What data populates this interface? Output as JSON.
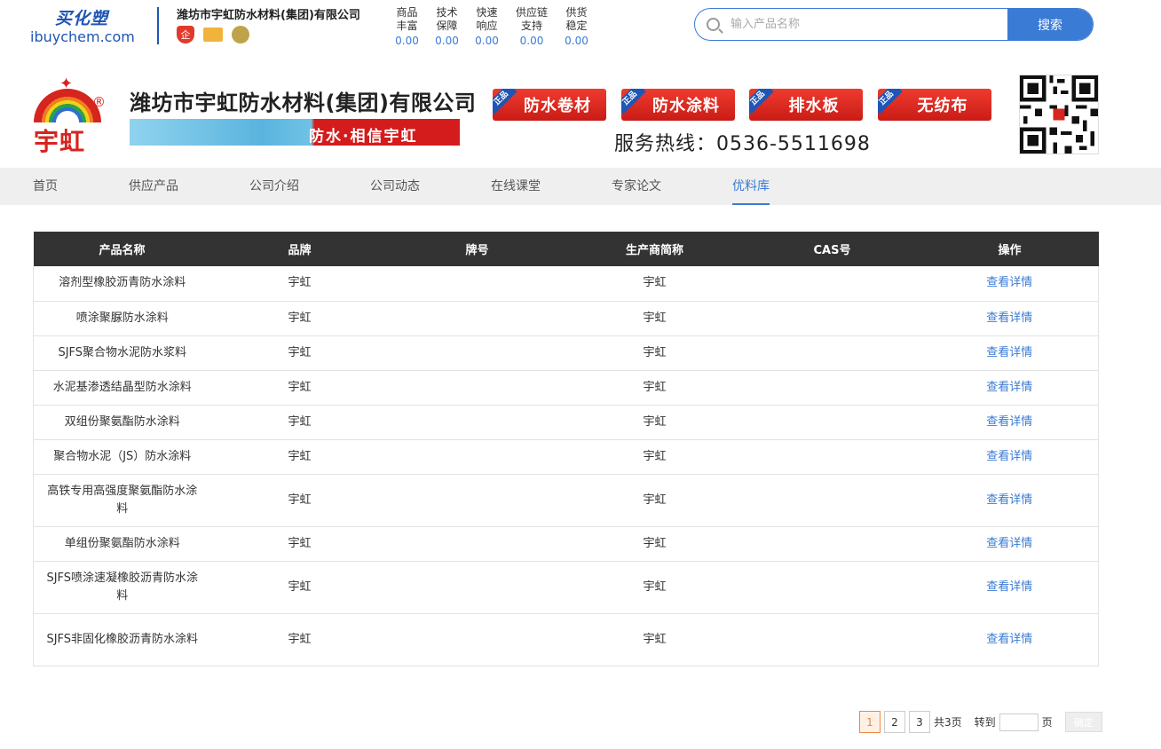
{
  "header": {
    "logo_cn": "买化塑",
    "logo_en_a": "ibuy",
    "logo_en_b": "chem",
    "logo_en_c": ".com",
    "company": "潍坊市宇虹防水材料(集团)有限公司",
    "badge_qi": "企",
    "metrics": [
      {
        "l1": "商品",
        "l2": "丰富",
        "v": "0.00"
      },
      {
        "l1": "技术",
        "l2": "保障",
        "v": "0.00"
      },
      {
        "l1": "快速",
        "l2": "响应",
        "v": "0.00"
      },
      {
        "l1": "供应链",
        "l2": "支持",
        "v": "0.00"
      },
      {
        "l1": "供货",
        "l2": "稳定",
        "v": "0.00"
      }
    ],
    "search": {
      "placeholder": "输入产品名称",
      "button": "搜索"
    }
  },
  "banner": {
    "brand": "宇虹",
    "title": "潍坊市宇虹防水材料(集团)有限公司",
    "slogan": "防水·相信宇虹",
    "tag": "正品",
    "products": [
      "防水卷材",
      "防水涂料",
      "排水板",
      "无纺布"
    ],
    "hotline": "服务热线：0536-5511698"
  },
  "nav": {
    "items": [
      "首页",
      "供应产品",
      "公司介绍",
      "公司动态",
      "在线课堂",
      "专家论文",
      "优料库"
    ],
    "active": "优料库"
  },
  "table": {
    "headers": [
      "产品名称",
      "品牌",
      "牌号",
      "生产商简称",
      "CAS号",
      "操作"
    ],
    "rows": [
      {
        "name": "溶剂型橡胶沥青防水涂料",
        "brand": "宇虹",
        "grade": "",
        "maker": "宇虹",
        "cas": "",
        "action": "查看详情"
      },
      {
        "name": "喷涂聚脲防水涂料",
        "brand": "宇虹",
        "grade": "",
        "maker": "宇虹",
        "cas": "",
        "action": "查看详情"
      },
      {
        "name": "SJFS聚合物水泥防水浆料",
        "brand": "宇虹",
        "grade": "",
        "maker": "宇虹",
        "cas": "",
        "action": "查看详情"
      },
      {
        "name": "水泥基渗透结晶型防水涂料",
        "brand": "宇虹",
        "grade": "",
        "maker": "宇虹",
        "cas": "",
        "action": "查看详情"
      },
      {
        "name": "双组份聚氨酯防水涂料",
        "brand": "宇虹",
        "grade": "",
        "maker": "宇虹",
        "cas": "",
        "action": "查看详情"
      },
      {
        "name": "聚合物水泥（JS）防水涂料",
        "brand": "宇虹",
        "grade": "",
        "maker": "宇虹",
        "cas": "",
        "action": "查看详情"
      },
      {
        "name": "高铁专用高强度聚氨酯防水涂料",
        "brand": "宇虹",
        "grade": "",
        "maker": "宇虹",
        "cas": "",
        "action": "查看详情"
      },
      {
        "name": "单组份聚氨酯防水涂料",
        "brand": "宇虹",
        "grade": "",
        "maker": "宇虹",
        "cas": "",
        "action": "查看详情"
      },
      {
        "name": "SJFS喷涂速凝橡胶沥青防水涂料",
        "brand": "宇虹",
        "grade": "",
        "maker": "宇虹",
        "cas": "",
        "action": "查看详情"
      },
      {
        "name": "SJFS非固化橡胶沥青防水涂料",
        "brand": "宇虹",
        "grade": "",
        "maker": "宇虹",
        "cas": "",
        "action": "查看详情"
      }
    ]
  },
  "pager": {
    "pages": [
      "1",
      "2",
      "3"
    ],
    "current": "1",
    "total": "共3页",
    "goto": "转到",
    "unit": "页",
    "confirm": "确定"
  },
  "colors": {
    "accent": "#3a7bd5",
    "brand_red": "#d6241f",
    "table_header": "#333333",
    "pager_current": "#f2873a"
  }
}
